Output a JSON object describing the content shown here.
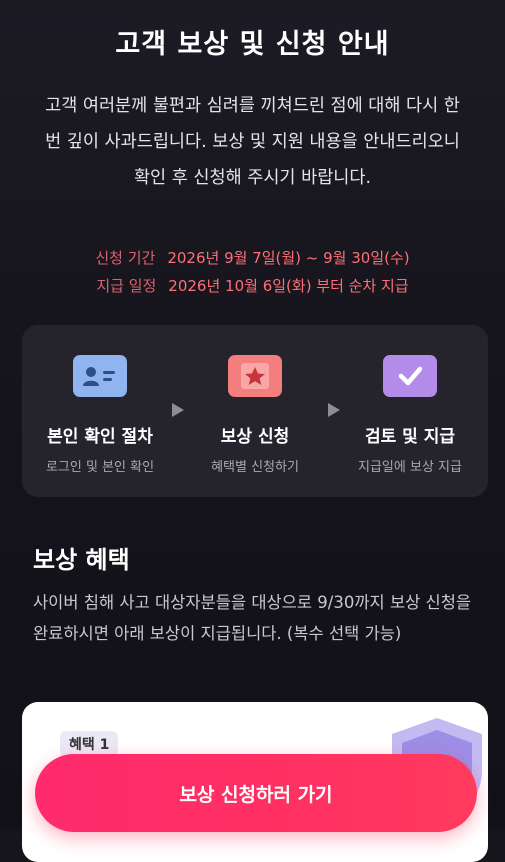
{
  "header": {
    "title": "고객 보상 및 신청 안내",
    "intro": "고객 여러분께 불편과 심려를 끼쳐드린 점에 대해 다시 한번 깊이 사과드립니다. 보상 및 지원 내용을 안내드리오니 확인 후 신청해 주시기 바랍니다."
  },
  "schedule": {
    "apply_label": "신청 기간",
    "apply_value": "2026년 9월 7일(월) ~ 9월 30일(수)",
    "pay_label": "지급 일정",
    "pay_value": "2026년 10월 6일(화) 부터 순차 지급"
  },
  "steps": [
    {
      "name": "본인 확인 절차",
      "desc": "로그인 및 본인 확인",
      "icon": "id-card-icon",
      "color": "#8fb4f0"
    },
    {
      "name": "보상 신청",
      "desc": "혜택별 신청하기",
      "icon": "star-icon",
      "color": "#f47d7d"
    },
    {
      "name": "검토 및 지급",
      "desc": "지급일에 보상 지급",
      "icon": "check-icon",
      "color": "#b28ce8"
    }
  ],
  "benefits": {
    "title": "보상 혜택",
    "desc": "사이버 침해 사고 대상자분들을 대상으로 9/30까지 보상 신청을 완료하시면 아래 보상이 지급됩니다. (복수 선택 가능)",
    "card_tag": "혜택 1"
  },
  "cta": {
    "label": "보상 신청하러 가기",
    "color": "#ff2e65"
  }
}
